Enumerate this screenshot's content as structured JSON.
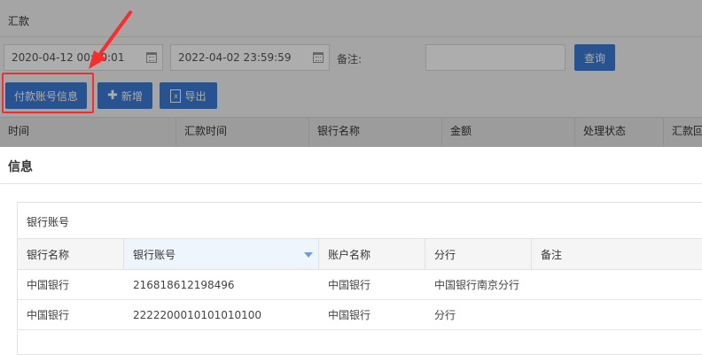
{
  "background": {
    "title": "汇款",
    "start_date": "2020-04-12 00:00:01",
    "end_date": "2022-04-02 23:59:59",
    "remark_label": "备注:",
    "remark_value": "",
    "query_label": "查询",
    "account_info_label": "付款账号信息",
    "add_label": "新增",
    "export_label": "导出",
    "columns": [
      "时间",
      "汇款时间",
      "银行名称",
      "金额",
      "处理状态",
      "汇款回"
    ]
  },
  "dialog": {
    "title": "信息",
    "panel_title": "银行账号",
    "columns": [
      "银行名称",
      "银行账号",
      "账户名称",
      "分行",
      "备注"
    ],
    "rows": [
      {
        "bank": "中国银行",
        "account": "216818612198496",
        "holder": "中国银行",
        "branch": "中国银行南京分行",
        "remark": ""
      },
      {
        "bank": "中国银行",
        "account": "2222200010101010100",
        "holder": "中国银行",
        "branch": "分行",
        "remark": ""
      }
    ]
  },
  "colors": {
    "primary_button": "#3a7bd5",
    "highlight": "#ff2a2a",
    "arrow": "#ff2a2a"
  }
}
